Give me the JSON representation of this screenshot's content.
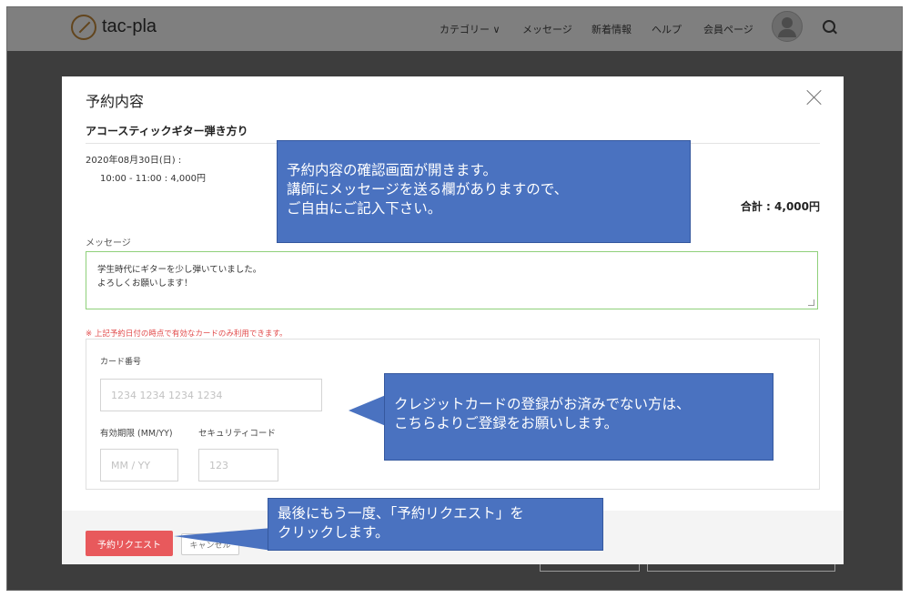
{
  "nav": {
    "brand": "tac-pla",
    "items": [
      "カテゴリー ∨",
      "メッセージ",
      "新着情報",
      "ヘルプ",
      "会員ページ"
    ]
  },
  "modal": {
    "title": "予約内容",
    "course": "アコースティックギター弾き方り",
    "date": "2020年08月30日(日) :",
    "time": "10:00 - 11:00 : 4,000円",
    "total": "合計 : 4,000円",
    "message_label": "メッセージ",
    "message_lines": [
      "学生時代にギターを少し弾いていました。",
      "よろしくお願いします！"
    ],
    "notice": "※ 上記予約日付の時点で有効なカードのみ利用できます。",
    "card_label": "カード番号",
    "card_placeholder": "1234 1234 1234 1234",
    "expiry_label": "有効期限 (MM/YY)",
    "expiry_placeholder": "MM / YY",
    "cvc_label": "セキュリティコード",
    "cvc_placeholder": "123",
    "request_button": "予約リクエスト",
    "cancel_button": "キャンセル"
  },
  "callouts": {
    "top": [
      "予約内容の確認画面が開きます。",
      "講師にメッセージを送る欄がありますので、",
      "ご自由にご記入下さい。"
    ],
    "middle": [
      "クレジットカードの登録がお済みでない方は、",
      "こちらよりご登録をお願いします。"
    ],
    "bottom": [
      "最後にもう一度、「予約リクエスト」を",
      "クリックします。"
    ]
  },
  "colors": {
    "callout": "#4a72c0",
    "primary_button": "#e8595c",
    "message_border": "#8fd07a",
    "notice": "#e24b4b"
  }
}
